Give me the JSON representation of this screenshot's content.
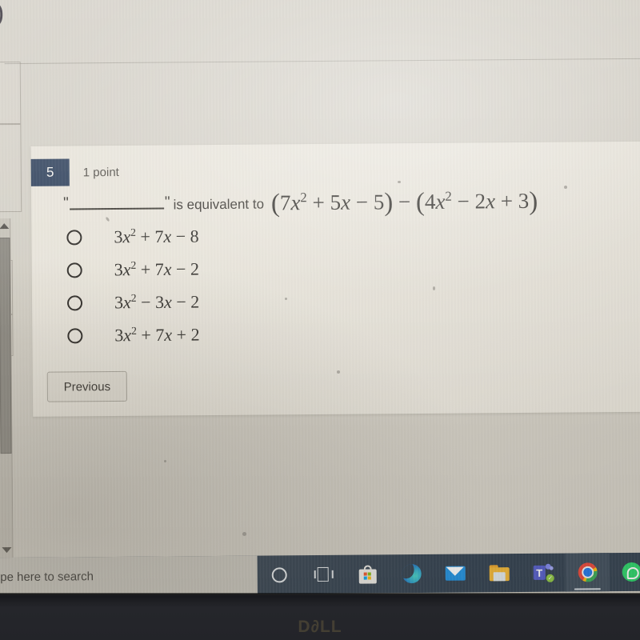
{
  "quiz": {
    "question_number": "5",
    "points_label": "1 point",
    "prompt": {
      "open_quote": "\"",
      "close_quote": "\"",
      "connector": "is equivalent to",
      "expression_plain": "(7x^2 + 5x - 5) - (4x^2 - 2x + 3)",
      "expr_paren_open_1": "(",
      "expr_coef_7": "7",
      "expr_var_x_1": "x",
      "expr_sup_2_1": "2",
      "expr_plus_1": "+",
      "expr_5x": "5",
      "expr_var_x_2": "x",
      "expr_minus_1": "−",
      "expr_const_5": "5",
      "expr_paren_close_1": ")",
      "expr_minus_outer": "−",
      "expr_paren_open_2": "(",
      "expr_coef_4": "4",
      "expr_var_x_3": "x",
      "expr_sup_2_2": "2",
      "expr_minus_2": "−",
      "expr_2x": "2",
      "expr_var_x_4": "x",
      "expr_plus_2": "+",
      "expr_const_3": "3",
      "expr_paren_close_2": ")"
    },
    "options": [
      {
        "id": "option-a",
        "selected": false,
        "plain": "3x^2 + 7x - 8",
        "coef": "3",
        "var1": "x",
        "sup1": "2",
        "op1": "+",
        "mid_coef": "7",
        "var2": "x",
        "op2": "−",
        "const": "8"
      },
      {
        "id": "option-b",
        "selected": false,
        "plain": "3x^2 + 7x - 2",
        "coef": "3",
        "var1": "x",
        "sup1": "2",
        "op1": "+",
        "mid_coef": "7",
        "var2": "x",
        "op2": "−",
        "const": "2"
      },
      {
        "id": "option-c",
        "selected": false,
        "plain": "3x^2 - 3x - 2",
        "coef": "3",
        "var1": "x",
        "sup1": "2",
        "op1": "−",
        "mid_coef": "3",
        "var2": "x",
        "op2": "−",
        "const": "2"
      },
      {
        "id": "option-d",
        "selected": false,
        "plain": "3x^2 + 7x + 2",
        "coef": "3",
        "var1": "x",
        "sup1": "2",
        "op1": "+",
        "mid_coef": "7",
        "var2": "x",
        "op2": "+",
        "const": "2"
      }
    ],
    "previous_button_label": "Previous",
    "badge_color": "#2c3e59"
  },
  "taskbar": {
    "search_placeholder": "ype here to search",
    "items": [
      {
        "name": "cortana-icon",
        "label": "Cortana"
      },
      {
        "name": "task-view-icon",
        "label": "Task View"
      },
      {
        "name": "microsoft-store-icon",
        "label": "Microsoft Store"
      },
      {
        "name": "edge-icon",
        "label": "Microsoft Edge"
      },
      {
        "name": "mail-icon",
        "label": "Mail"
      },
      {
        "name": "file-explorer-icon",
        "label": "File Explorer"
      },
      {
        "name": "microsoft-teams-icon",
        "label": "Microsoft Teams",
        "badge": "✓"
      },
      {
        "name": "chrome-icon",
        "label": "Google Chrome",
        "running": true
      },
      {
        "name": "whatsapp-icon",
        "label": "WhatsApp"
      }
    ],
    "background_color": "#2d3c4c"
  },
  "device": {
    "brand_logo": "D∂LL"
  }
}
